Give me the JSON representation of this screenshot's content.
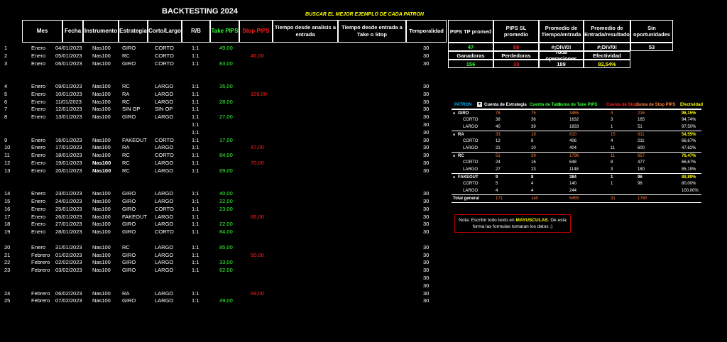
{
  "title": "BACKTESTING 2024",
  "subtitle": "BUSCAR EL MEJOR EJEMPLO DE CADA PATRON",
  "headers": [
    "Mes",
    "Fecha",
    "Instrumento",
    "Estrategia",
    "Corto/Largo",
    "R/B",
    "Take PIPS",
    "Stop PIPS",
    "Tiempo desde analisis a entrada",
    "Tiempo desde entrada a Take o Stop",
    "Temporalidad"
  ],
  "rows": [
    {
      "n": "1",
      "mes": "Enero",
      "fecha": "04/01/2023",
      "inst": "Nas100",
      "est": "GIRO",
      "cl": "CORTO",
      "rb": "1:1",
      "take": "49,00",
      "stop": "",
      "temp": "30"
    },
    {
      "n": "2",
      "mes": "Enero",
      "fecha": "05/01/2023",
      "inst": "Nas100",
      "est": "RC",
      "cl": "CORTO",
      "rb": "1:1",
      "take": "",
      "stop": "46,00",
      "temp": "30"
    },
    {
      "n": "3",
      "mes": "Enero",
      "fecha": "06/01/2023",
      "inst": "Nas100",
      "est": "GIRO",
      "cl": "CORTO",
      "rb": "1:1",
      "take": "83,00",
      "stop": "",
      "temp": "30"
    },
    {
      "n": "",
      "mes": "",
      "fecha": "",
      "inst": "",
      "est": "",
      "cl": "",
      "rb": "",
      "take": "",
      "stop": "",
      "temp": ""
    },
    {
      "n": "",
      "mes": "",
      "fecha": "",
      "inst": "",
      "est": "",
      "cl": "",
      "rb": "",
      "take": "",
      "stop": "",
      "temp": ""
    },
    {
      "n": "4",
      "mes": "Enero",
      "fecha": "09/01/2023",
      "inst": "Nas100",
      "est": "RC",
      "cl": "LARGO",
      "rb": "1:1",
      "take": "35,00",
      "stop": "",
      "temp": "30"
    },
    {
      "n": "5",
      "mes": "Enero",
      "fecha": "10/01/2023",
      "inst": "Nas100",
      "est": "RA",
      "cl": "LARGO",
      "rb": "1:1",
      "take": "",
      "stop": "109,00",
      "temp": "30"
    },
    {
      "n": "6",
      "mes": "Enero",
      "fecha": "11/01/2023",
      "inst": "Nas100",
      "est": "RC",
      "cl": "LARGO",
      "rb": "1:1",
      "take": "28,00",
      "stop": "",
      "temp": "30"
    },
    {
      "n": "7",
      "mes": "Enero",
      "fecha": "12/01/2023",
      "inst": "Nas100",
      "est": "SIN OP",
      "cl": "SIN OP",
      "rb": "1:1",
      "take": "",
      "stop": "",
      "temp": "30"
    },
    {
      "n": "8",
      "mes": "Enero",
      "fecha": "13/01/2023",
      "inst": "Nas100",
      "est": "GIRO",
      "cl": "LARGO",
      "rb": "1:1",
      "take": "27,00",
      "stop": "",
      "temp": "30"
    },
    {
      "n": "",
      "mes": "",
      "fecha": "",
      "inst": "",
      "est": "",
      "cl": "",
      "rb": "1:1",
      "take": "",
      "stop": "",
      "temp": "30"
    },
    {
      "n": "",
      "mes": "",
      "fecha": "",
      "inst": "",
      "est": "",
      "cl": "",
      "rb": "1:1",
      "take": "",
      "stop": "",
      "temp": "30"
    },
    {
      "n": "9",
      "mes": "Enero",
      "fecha": "16/01/2023",
      "inst": "Nas100",
      "est": "FAKEOUT",
      "cl": "CORTO",
      "rb": "1:1",
      "take": "17,00",
      "stop": "",
      "temp": "30"
    },
    {
      "n": "10",
      "mes": "Enero",
      "fecha": "17/01/2023",
      "inst": "Nas100",
      "est": "RA",
      "cl": "LARGO",
      "rb": "1:1",
      "take": "",
      "stop": "47,00",
      "temp": "30"
    },
    {
      "n": "11",
      "mes": "Enero",
      "fecha": "18/01/2023",
      "inst": "Nas100",
      "est": "RC",
      "cl": "CORTO",
      "rb": "1:1",
      "take": "84,00",
      "stop": "",
      "temp": "30"
    },
    {
      "n": "12",
      "mes": "Enero",
      "fecha": "19/01/2023",
      "inst": "Nas100",
      "est": "RC",
      "cl": "LARGO",
      "rb": "1:1",
      "take": "",
      "stop": "70,00",
      "temp": "30"
    },
    {
      "n": "13",
      "mes": "Enero",
      "fecha": "20/01/2023",
      "inst": "Nas100",
      "est": "RC",
      "cl": "LARGO",
      "rb": "1:1",
      "take": "69,00",
      "stop": "",
      "temp": "30"
    },
    {
      "n": "",
      "mes": "",
      "fecha": "",
      "inst": "",
      "est": "",
      "cl": "",
      "rb": "",
      "take": "",
      "stop": "",
      "temp": ""
    },
    {
      "n": "",
      "mes": "",
      "fecha": "",
      "inst": "",
      "est": "",
      "cl": "",
      "rb": "",
      "take": "",
      "stop": "",
      "temp": ""
    },
    {
      "n": "14",
      "mes": "Enero",
      "fecha": "23/01/2023",
      "inst": "Nas100",
      "est": "GIRO",
      "cl": "LARGO",
      "rb": "1:1",
      "take": "40,00",
      "stop": "",
      "temp": "30"
    },
    {
      "n": "15",
      "mes": "Enero",
      "fecha": "24/01/2023",
      "inst": "Nas100",
      "est": "GIRO",
      "cl": "LARGO",
      "rb": "1:1",
      "take": "22,00",
      "stop": "",
      "temp": "30"
    },
    {
      "n": "16",
      "mes": "Enero",
      "fecha": "25/01/2023",
      "inst": "Nas100",
      "est": "GIRO",
      "cl": "CORTO",
      "rb": "1:1",
      "take": "23,00",
      "stop": "",
      "temp": "30"
    },
    {
      "n": "17",
      "mes": "Enero",
      "fecha": "26/01/2023",
      "inst": "Nas100",
      "est": "FAKEOUT",
      "cl": "LARGO",
      "rb": "1:1",
      "take": "",
      "stop": "86,00",
      "temp": "30"
    },
    {
      "n": "18",
      "mes": "Enero",
      "fecha": "27/01/2023",
      "inst": "Nas100",
      "est": "GIRO",
      "cl": "LARGO",
      "rb": "1:1",
      "take": "22,00",
      "stop": "",
      "temp": "30"
    },
    {
      "n": "19",
      "mes": "Enero",
      "fecha": "28/01/2023",
      "inst": "Nas100",
      "est": "GIRO",
      "cl": "CORTO",
      "rb": "1:1",
      "take": "84,00",
      "stop": "",
      "temp": "30"
    },
    {
      "n": "",
      "mes": "",
      "fecha": "",
      "inst": "",
      "est": "",
      "cl": "",
      "rb": "",
      "take": "",
      "stop": "",
      "temp": ""
    },
    {
      "n": "20",
      "mes": "Enero",
      "fecha": "31/01/2023",
      "inst": "Nas100",
      "est": "RC",
      "cl": "LARGO",
      "rb": "1:1",
      "take": "85,00",
      "stop": "",
      "temp": "30"
    },
    {
      "n": "21",
      "mes": "Febrero",
      "fecha": "01/02/2023",
      "inst": "Nas100",
      "est": "GIRO",
      "cl": "LARGO",
      "rb": "1:1",
      "take": "",
      "stop": "50,00",
      "temp": "30"
    },
    {
      "n": "22",
      "mes": "Febrero",
      "fecha": "02/02/2023",
      "inst": "Nas100",
      "est": "GIRO",
      "cl": "LARGO",
      "rb": "1:1",
      "take": "33,00",
      "stop": "",
      "temp": "30"
    },
    {
      "n": "23",
      "mes": "Febrero",
      "fecha": "03/02/2023",
      "inst": "Nas100",
      "est": "GIRO",
      "cl": "LARGO",
      "rb": "1:1",
      "take": "62,00",
      "stop": "",
      "temp": "30"
    },
    {
      "n": "",
      "mes": "",
      "fecha": "",
      "inst": "",
      "est": "",
      "cl": "",
      "rb": "",
      "take": "",
      "stop": "",
      "temp": "30"
    },
    {
      "n": "",
      "mes": "",
      "fecha": "",
      "inst": "",
      "est": "",
      "cl": "",
      "rb": "",
      "take": "",
      "stop": "",
      "temp": "30"
    },
    {
      "n": "24",
      "mes": "Febrero",
      "fecha": "06/02/2023",
      "inst": "Nas100",
      "est": "RA",
      "cl": "LARGO",
      "rb": "1:1",
      "take": "",
      "stop": "69,00",
      "temp": "30"
    },
    {
      "n": "25",
      "mes": "Febrero",
      "fecha": "07/02/2023",
      "inst": "Nas100",
      "est": "GIRO",
      "cl": "LARGO",
      "rb": "1:1",
      "take": "49,00",
      "stop": "",
      "temp": "30"
    }
  ],
  "summary": {
    "headers": [
      "PIPS TP promed",
      "PIPS SL promedio",
      "Promedio de Tiempo/entrada",
      "Promedio de Entrada/resultado",
      "Sin oportunidades"
    ],
    "values": [
      "47",
      "58",
      "#¡DIV/0!",
      "#¡DIV/0!",
      "53"
    ],
    "headers2": [
      "Ganadoras",
      "Perdedoras",
      "Total operaciones",
      "Efectividad"
    ],
    "values2": [
      "156",
      "33",
      "189",
      "82,54%"
    ]
  },
  "pivot": {
    "headers": [
      "PATRON",
      "Cuenta de Estrategia",
      "Cuenta de Take",
      "Suma de Take PIPS",
      "Cuenta de Stop",
      "Suma de Stop PIPS",
      "Efectividad"
    ],
    "rows": [
      {
        "type": "group",
        "label": "GIRO",
        "v": [
          "78",
          "75",
          "3465",
          "4",
          "216",
          "96,15%"
        ]
      },
      {
        "type": "sub",
        "label": "CORTO",
        "v": [
          "38",
          "36",
          "1632",
          "3",
          "165",
          "94,74%"
        ]
      },
      {
        "type": "sub",
        "label": "LARGO",
        "v": [
          "40",
          "39",
          "1833",
          "1",
          "51",
          "97,50%"
        ]
      },
      {
        "type": "group",
        "label": "RA",
        "v": [
          "33",
          "18",
          "810",
          "15",
          "811",
          "54,55%"
        ]
      },
      {
        "type": "sub",
        "label": "CORTO",
        "v": [
          "12",
          "8",
          "406",
          "4",
          "211",
          "66,67%"
        ]
      },
      {
        "type": "sub",
        "label": "LARGO",
        "v": [
          "21",
          "10",
          "404",
          "11",
          "600",
          "47,62%"
        ]
      },
      {
        "type": "group",
        "label": "RC",
        "v": [
          "51",
          "39",
          "1796",
          "11",
          "657",
          "76,47%"
        ]
      },
      {
        "type": "sub",
        "label": "CORTO",
        "v": [
          "24",
          "16",
          "648",
          "8",
          "477",
          "66,67%"
        ]
      },
      {
        "type": "sub",
        "label": "LARGO",
        "v": [
          "27",
          "23",
          "1148",
          "3",
          "180",
          "85,19%"
        ]
      },
      {
        "type": "group2",
        "label": "FAKEOUT",
        "v": [
          "9",
          "8",
          "384",
          "1",
          "96",
          "88,89%"
        ]
      },
      {
        "type": "sub",
        "label": "CORTO",
        "v": [
          "5",
          "4",
          "140",
          "1",
          "96",
          "80,00%"
        ]
      },
      {
        "type": "sub",
        "label": "LARGO",
        "v": [
          "4",
          "4",
          "244",
          "",
          "",
          "100,00%"
        ]
      },
      {
        "type": "total",
        "label": "Total general",
        "v": [
          "171",
          "140",
          "6455",
          "31",
          "1780",
          ""
        ]
      }
    ]
  },
  "note": {
    "prefix": "Nota: Escribir todo texto en ",
    "highlight": "MAYUSCULAS",
    "suffix": ". De esta forma las formulas tomaran los datos :)"
  },
  "colors": {
    "green": "#33ff33",
    "red": "#ff2020",
    "yellow": "#ffff00",
    "orange": "#ff8040",
    "cyan": "#00b0f0"
  }
}
